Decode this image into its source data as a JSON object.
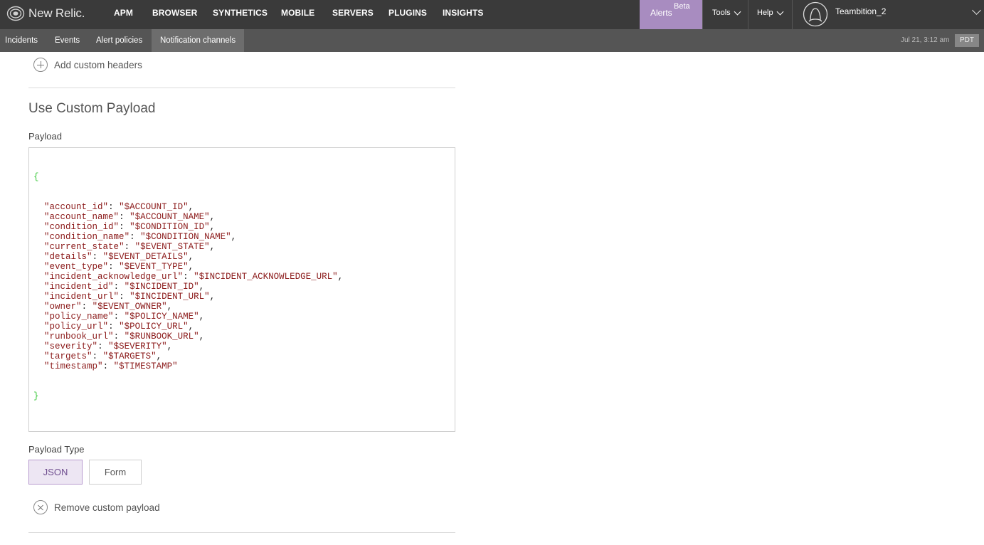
{
  "brand": {
    "name": "New Relic.",
    "accent": "#a88cc0"
  },
  "nav": {
    "items": [
      "APM",
      "BROWSER",
      "SYNTHETICS",
      "MOBILE",
      "SERVERS",
      "PLUGINS",
      "INSIGHTS"
    ],
    "alerts": {
      "label": "Alerts",
      "badge": "Beta"
    },
    "tools": "Tools",
    "help": "Help",
    "account": "Teambition_2"
  },
  "subnav": {
    "items": [
      "Incidents",
      "Events",
      "Alert policies",
      "Notification channels"
    ],
    "active": "Notification channels",
    "datetime": "Jul 21, 3:12 am",
    "timezone": "PDT"
  },
  "content": {
    "add_headers": "Add custom headers",
    "section_title": "Use Custom Payload",
    "payload_label": "Payload",
    "payload_open": "{",
    "payload_close": "}",
    "payload_lines": [
      {
        "key": "account_id",
        "value": "$ACCOUNT_ID"
      },
      {
        "key": "account_name",
        "value": "$ACCOUNT_NAME"
      },
      {
        "key": "condition_id",
        "value": "$CONDITION_ID"
      },
      {
        "key": "condition_name",
        "value": "$CONDITION_NAME"
      },
      {
        "key": "current_state",
        "value": "$EVENT_STATE"
      },
      {
        "key": "details",
        "value": "$EVENT_DETAILS"
      },
      {
        "key": "event_type",
        "value": "$EVENT_TYPE"
      },
      {
        "key": "incident_acknowledge_url",
        "value": "$INCIDENT_ACKNOWLEDGE_URL"
      },
      {
        "key": "incident_id",
        "value": "$INCIDENT_ID"
      },
      {
        "key": "incident_url",
        "value": "$INCIDENT_URL"
      },
      {
        "key": "owner",
        "value": "$EVENT_OWNER"
      },
      {
        "key": "policy_name",
        "value": "$POLICY_NAME"
      },
      {
        "key": "policy_url",
        "value": "$POLICY_URL"
      },
      {
        "key": "runbook_url",
        "value": "$RUNBOOK_URL"
      },
      {
        "key": "severity",
        "value": "$SEVERITY"
      },
      {
        "key": "targets",
        "value": "$TARGETS"
      },
      {
        "key": "timestamp",
        "value": "$TIMESTAMP"
      }
    ],
    "payload_type_label": "Payload Type",
    "payload_types": [
      "JSON",
      "Form"
    ],
    "payload_type_selected": "JSON",
    "remove_payload": "Remove custom payload"
  }
}
